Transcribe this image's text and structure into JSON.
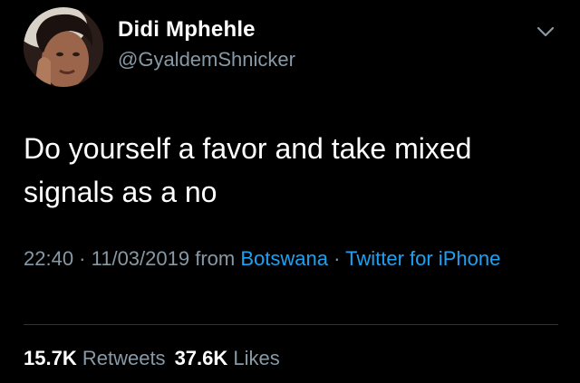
{
  "tweet": {
    "user": {
      "name": "Didi Mphehle",
      "handle": "@GyaldemShnicker",
      "avatar_icon": "profile-photo"
    },
    "text": "Do yourself a favor and take mixed signals as a no",
    "meta": {
      "time": "22:40",
      "separator": " · ",
      "date": "11/03/2019",
      "from_label": " from ",
      "location": "Botswana",
      "source": "Twitter for iPhone"
    },
    "stats": {
      "retweets_count": "15.7K",
      "retweets_label": "Retweets",
      "likes_count": "37.6K",
      "likes_label": "Likes"
    },
    "menu_icon": "chevron-down-icon"
  },
  "colors": {
    "background": "#000000",
    "primary_text": "#ffffff",
    "secondary_text": "#8899a6",
    "link": "#1da1f2",
    "divider": "#2f3336"
  }
}
